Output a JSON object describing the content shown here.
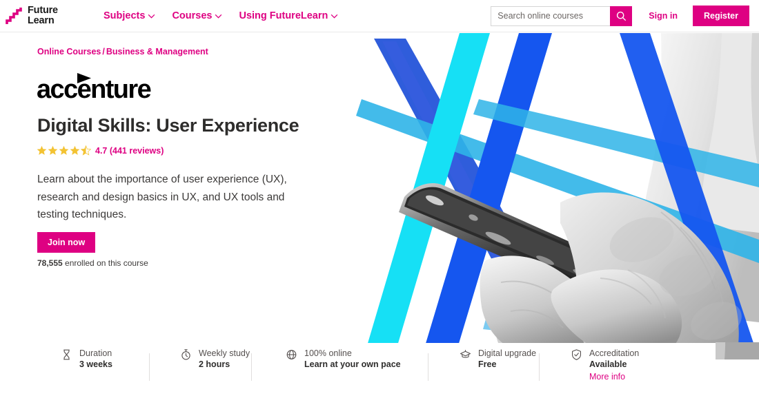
{
  "brand": {
    "accent": "#de0082",
    "logo_name": "futurelearn-logo",
    "logo_line1": "Future",
    "logo_line2": "Learn"
  },
  "header": {
    "nav": [
      {
        "label": "Subjects",
        "icon": "chevron-down-icon"
      },
      {
        "label": "Courses",
        "icon": "chevron-down-icon"
      },
      {
        "label": "Using FutureLearn",
        "icon": "chevron-down-icon"
      }
    ],
    "search": {
      "placeholder": "Search online courses",
      "value": "",
      "icon": "search-icon"
    },
    "sign_in": "Sign in",
    "register": "Register"
  },
  "breadcrumb": {
    "items": [
      "Online Courses",
      "Business & Management"
    ],
    "separator": "/"
  },
  "course": {
    "provider_logo": "accenture-logo",
    "provider_name": "accenture",
    "title": "Digital Skills: User Experience",
    "rating_value": "4.7",
    "rating_stars": 4.5,
    "rating_text": "4.7 (441 reviews)",
    "star_color": "#f3c333",
    "description": "Learn about the importance of user experience (UX), research and design basics in UX, and UX tools and testing techniques.",
    "cta_label": "Join now",
    "enrolled_count": "78,555",
    "enrolled_suffix": " enrolled on this course"
  },
  "hero": {
    "alt": "hands holding a smartphone with blue diagonal stripes",
    "stripe_colors": [
      "#16e0f5",
      "#1556ef",
      "#3a63e0",
      "#29a9e8"
    ]
  },
  "stats": [
    {
      "icon": "hourglass-icon",
      "label": "Duration",
      "value": "3 weeks",
      "link": ""
    },
    {
      "icon": "stopwatch-icon",
      "label": "Weekly study",
      "value": "2 hours",
      "link": ""
    },
    {
      "icon": "globe-icon",
      "label": "100% online",
      "value": "Learn at your own pace",
      "link": ""
    },
    {
      "icon": "graduation-cap-icon",
      "label": "Digital upgrade",
      "value": "Free",
      "link": ""
    },
    {
      "icon": "shield-check-icon",
      "label": "Accreditation",
      "value": "Available",
      "link": "More info"
    }
  ]
}
